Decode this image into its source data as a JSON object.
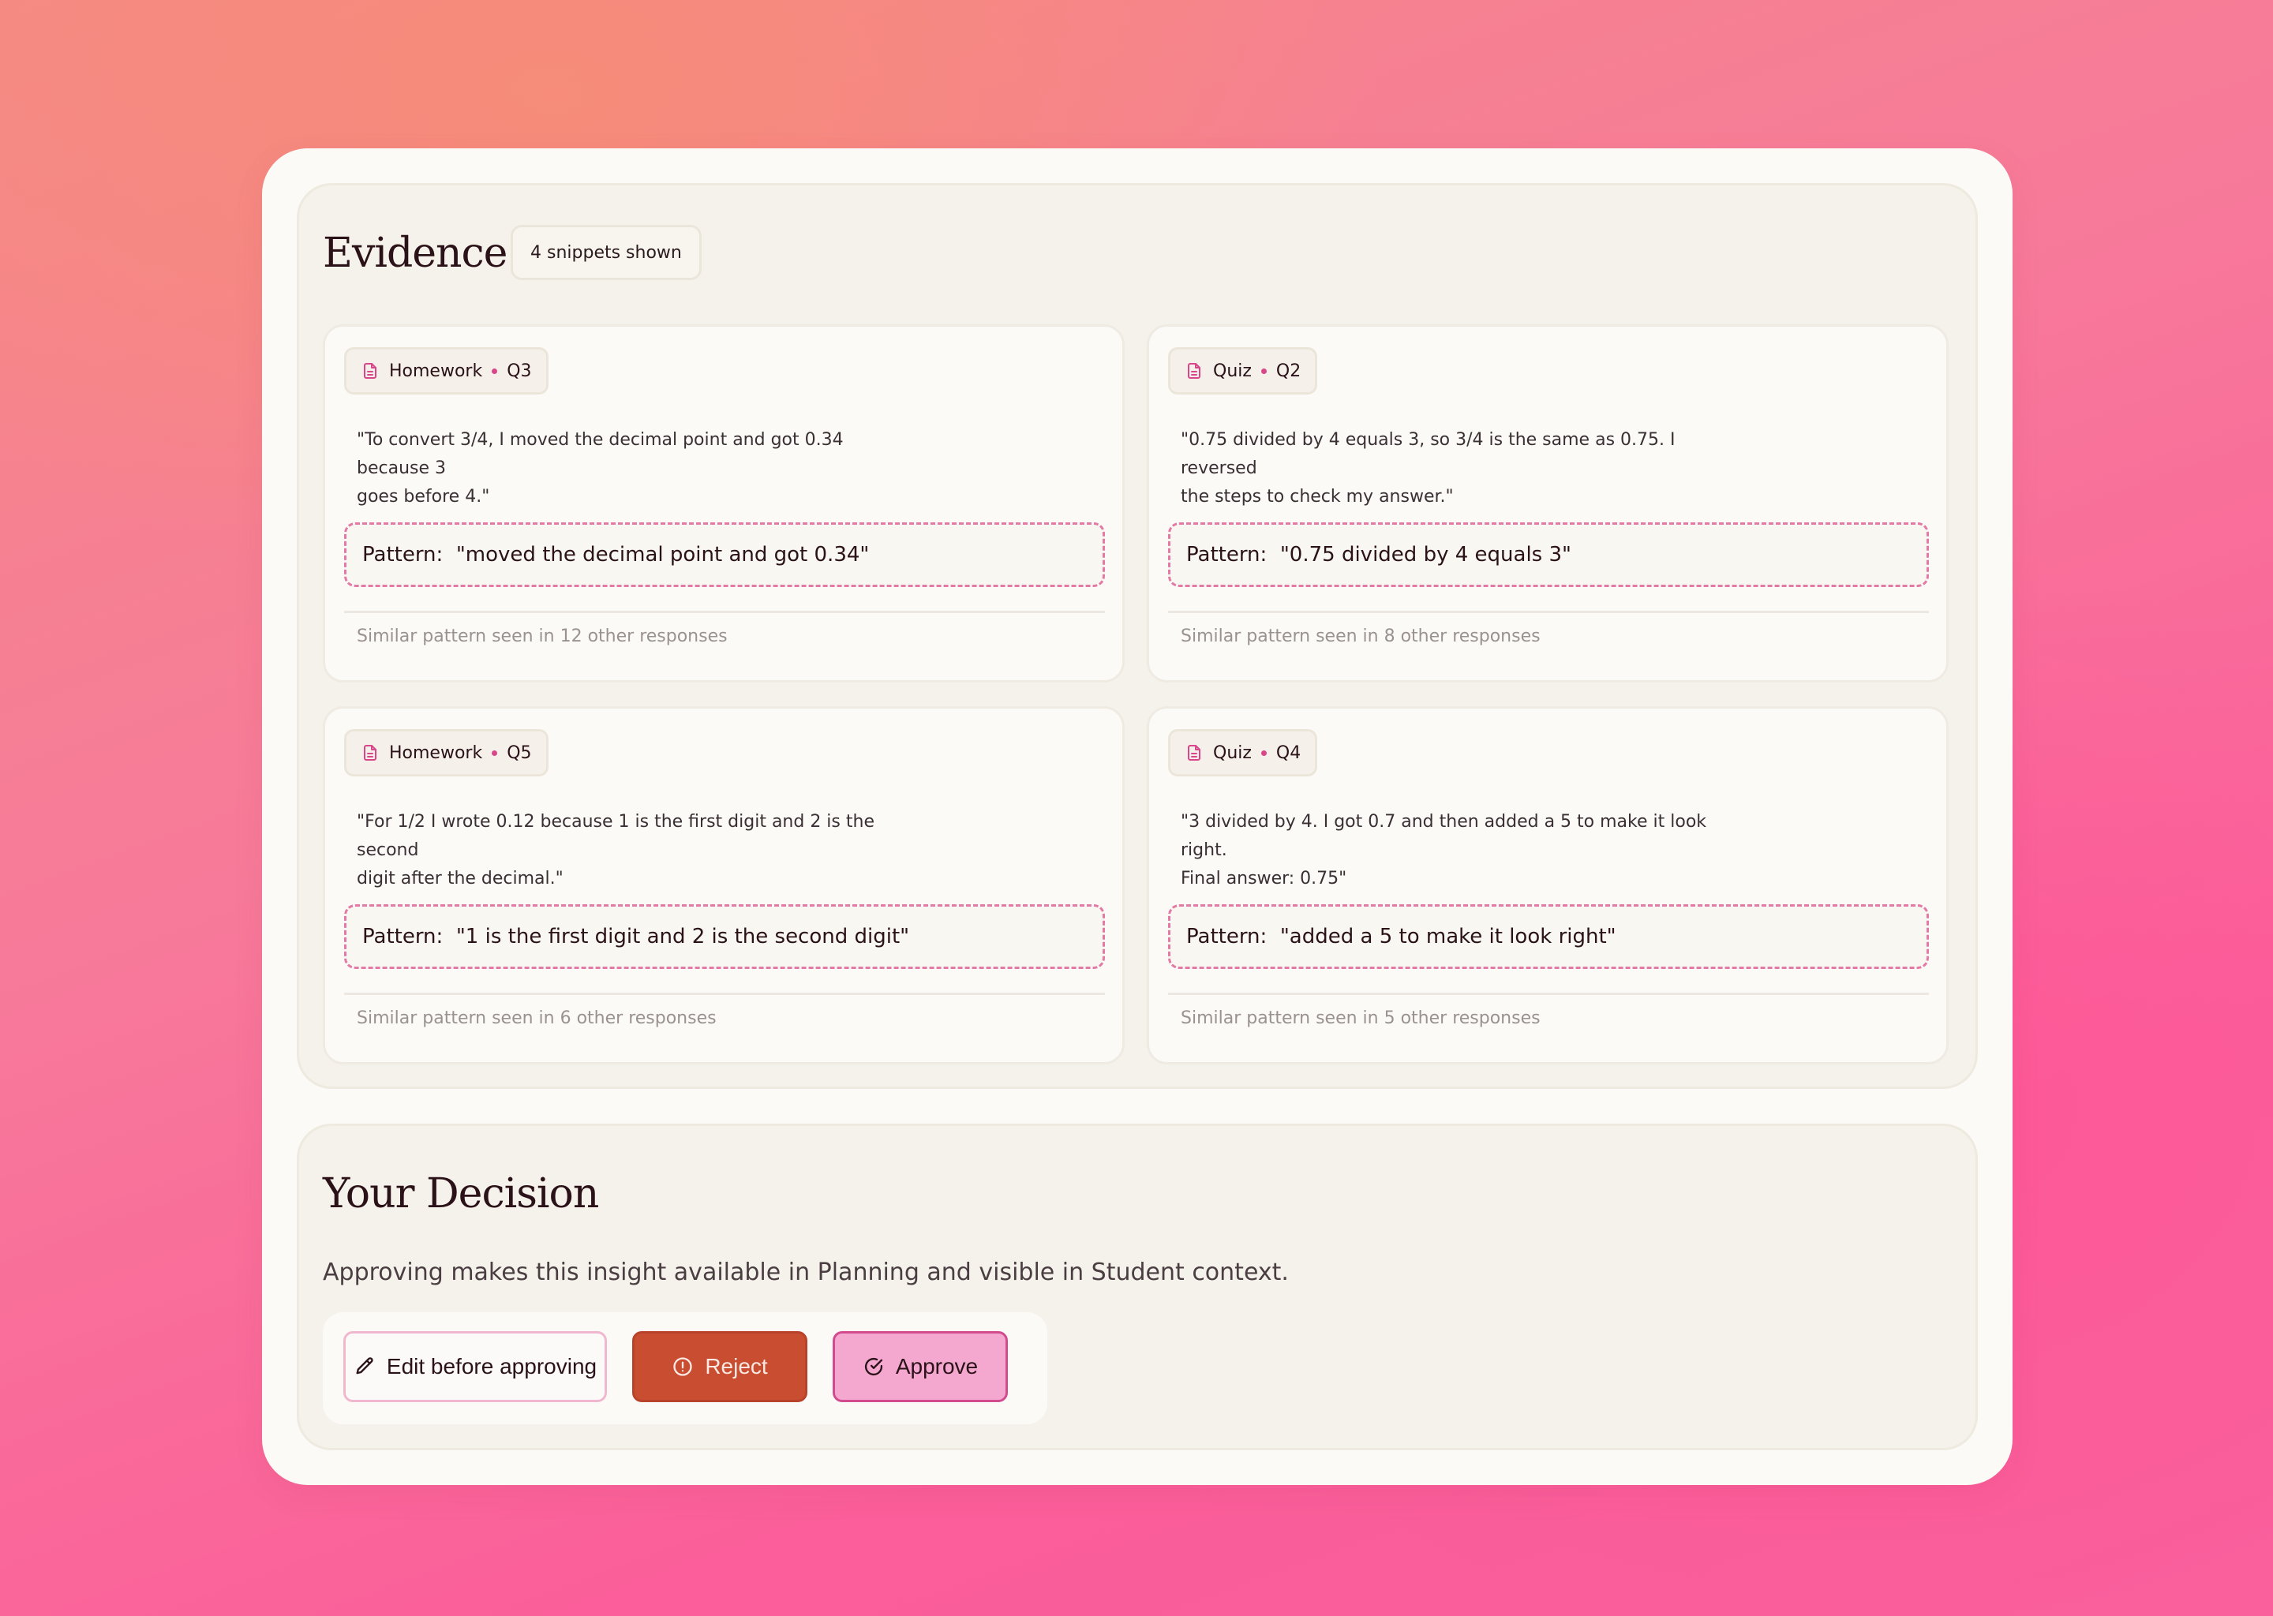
{
  "evidence": {
    "title": "Evidence",
    "count_badge": "4 snippets shown",
    "cards": [
      {
        "source": "Homework",
        "question": "Q3",
        "quote_line1": "\"To convert 3/4, I moved the decimal point and got 0.34 because 3",
        "quote_line2": "goes before 4.\"",
        "pattern_prefix": "Pattern:",
        "pattern": "\"moved the decimal point and got 0.34\"",
        "similar": "Similar pattern seen in 12 other responses"
      },
      {
        "source": "Quiz",
        "question": "Q2",
        "quote_line1": "\"0.75 divided by 4 equals 3, so 3/4 is the same as 0.75. I reversed",
        "quote_line2": "the steps to check my answer.\"",
        "pattern_prefix": "Pattern:",
        "pattern": "\"0.75 divided by 4 equals 3\"",
        "similar": "Similar pattern seen in 8 other responses"
      },
      {
        "source": "Homework",
        "question": "Q5",
        "quote_line1": "\"For 1/2 I wrote 0.12 because 1 is the first digit and 2 is the second",
        "quote_line2": "digit after the decimal.\"",
        "pattern_prefix": "Pattern:",
        "pattern": "\"1 is the first digit and 2 is the second digit\"",
        "similar": "Similar pattern seen in 6 other responses"
      },
      {
        "source": "Quiz",
        "question": "Q4",
        "quote_line1": "\"3 divided by 4. I got 0.7 and then added a 5 to make it look right.",
        "quote_line2": "Final answer: 0.75\"",
        "pattern_prefix": "Pattern:",
        "pattern": "\"added a 5 to make it look right\"",
        "similar": "Similar pattern seen in 5 other responses"
      }
    ]
  },
  "decision": {
    "title": "Your Decision",
    "description": "Approving makes this insight available in Planning and visible in Student context.",
    "edit_label": "Edit before approving",
    "reject_label": "Reject",
    "approve_label": "Approve"
  },
  "colors": {
    "accent_pink": "#d9478a",
    "reject": "#c94d30",
    "approve": "#f4a8cf"
  },
  "icons": {
    "source": "file-text-icon",
    "edit": "pencil-icon",
    "reject": "alert-circle-icon",
    "approve": "check-circle-icon"
  }
}
